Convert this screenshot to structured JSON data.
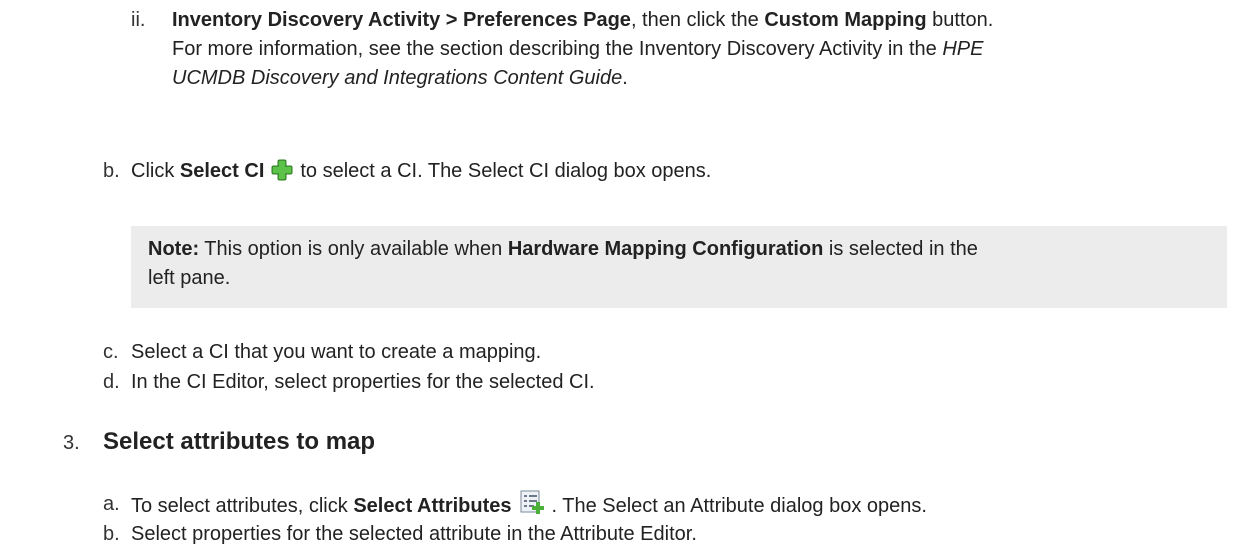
{
  "step_a_ii": {
    "marker": "ii.",
    "line1": {
      "path_bold": "Inventory Discovery Activity > Preferences Page",
      "mid": ", then click the ",
      "button_bold": "Custom Mapping",
      "end": " button."
    },
    "line2": {
      "text": "For more information, see the section describing the Inventory Discovery Activity in the ",
      "italic": "HPE"
    },
    "line3": {
      "italic": "UCMDB Discovery and Integrations Content Guide",
      "end": "."
    }
  },
  "step_b": {
    "marker": "b.",
    "pre": "Click ",
    "bold": "Select CI",
    "icon": "green-plus-icon",
    "post": "to select a CI. The Select CI dialog box opens."
  },
  "note": {
    "label": "Note:",
    "pre": " This option is only available when ",
    "bold": "Hardware Mapping Configuration",
    "post": " is selected in the",
    "line2": "left pane."
  },
  "step_c": {
    "marker": "c.",
    "text": "Select a CI that you want to create a mapping."
  },
  "step_d": {
    "marker": "d.",
    "text": "In the CI Editor, select properties for the selected CI."
  },
  "section3": {
    "number": "3.",
    "title": "Select attributes to map"
  },
  "step3_a": {
    "marker": "a.",
    "pre": "To select attributes, click ",
    "bold": "Select Attributes",
    "icon": "select-attributes-icon",
    "post": ". The Select an Attribute dialog box opens."
  },
  "step3_b": {
    "marker": "b.",
    "text": "Select properties for the selected attribute in the Attribute Editor."
  },
  "colors": {
    "note_bg": "#ececec",
    "icon_green": "#4caf3a",
    "text": "#222222"
  }
}
